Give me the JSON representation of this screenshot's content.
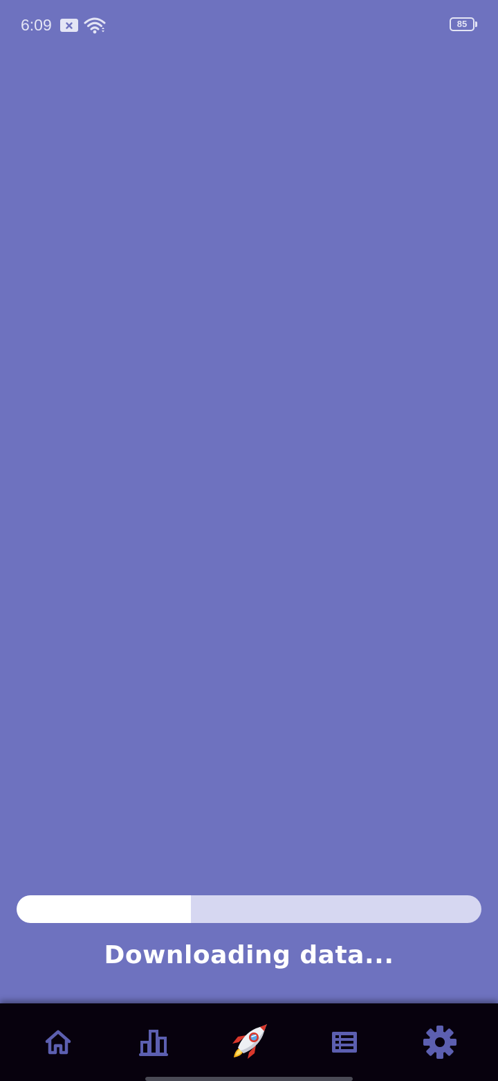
{
  "status_bar": {
    "time": "6:09",
    "battery": "85",
    "icons": [
      "notification-x-icon",
      "wifi-icon",
      "battery-icon"
    ]
  },
  "progress": {
    "value": 0.375
  },
  "loading": {
    "text": "Downloading data..."
  },
  "bottom_nav": {
    "items": [
      {
        "icon": "home-icon"
      },
      {
        "icon": "bar-chart-icon"
      },
      {
        "icon": "rocket-icon"
      },
      {
        "icon": "list-icon"
      },
      {
        "icon": "gear-icon"
      }
    ]
  },
  "colors": {
    "background": "#6e72bf",
    "nav_background": "#07010d",
    "nav_icon": "#5c5fb0",
    "progress_track": "#d6d7f1",
    "progress_fill": "#ffffff"
  }
}
